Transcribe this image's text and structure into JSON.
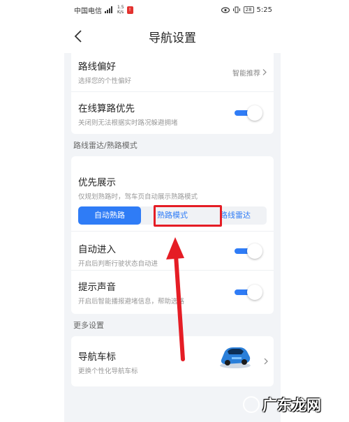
{
  "status": {
    "carrier": "中国电信",
    "net_speed_top": "1.5",
    "net_speed_bottom": "K/s",
    "battery": "28",
    "time": "5:25"
  },
  "header": {
    "title": "导航设置"
  },
  "route_pref": {
    "title": "路线偏好",
    "subtitle": "选择您的个性偏好",
    "value": "智能推荐"
  },
  "online_calc": {
    "title": "在线算路优先",
    "subtitle": "关闭则无法根据实时路况躲避拥堵",
    "enabled": true
  },
  "section_radar": {
    "label": "路线雷达/熟路模式"
  },
  "priority": {
    "title": "优先展示",
    "subtitle": "仅规划熟路时，驾车页自动展示熟路模式",
    "options": [
      "自动熟路",
      "熟路模式",
      "路线雷达"
    ],
    "selected": "自动熟路"
  },
  "auto_enter": {
    "title": "自动进入",
    "subtitle": "开启后判断行驶状态自动进",
    "enabled": true
  },
  "prompt_sound": {
    "title": "提示声音",
    "subtitle": "开启后智能播报避堵信息，帮助选路",
    "enabled": true
  },
  "section_more": {
    "label": "更多设置"
  },
  "nav_icon": {
    "title": "导航车标",
    "subtitle": "更换个性化导航车标"
  },
  "watermark": {
    "text": "广东龙网"
  },
  "colors": {
    "accent": "#2f7cf6",
    "annotation_red": "#e51d25"
  }
}
